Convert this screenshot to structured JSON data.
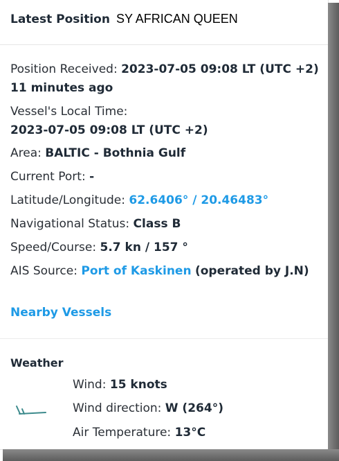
{
  "header": {
    "label": "Latest Position",
    "vessel_name": "SY AFRICAN QUEEN"
  },
  "details": {
    "position_received_label": "Position Received:",
    "position_received_value": "2023-07-05 09:08 LT (UTC +2)",
    "position_age": "11 minutes ago",
    "local_time_label": "Vessel's Local Time:",
    "local_time_value": "2023-07-05 09:08 LT (UTC +2)",
    "area_label": "Area:",
    "area_value": "BALTIC - Bothnia Gulf",
    "current_port_label": "Current Port:",
    "current_port_value": "-",
    "latlon_label": "Latitude/Longitude:",
    "latlon_value": "62.6406° / 20.46483°",
    "nav_status_label": "Navigational Status:",
    "nav_status_value": "Class B",
    "speed_course_label": "Speed/Course:",
    "speed_course_value": "5.7 kn / 157 °",
    "ais_source_label": "AIS Source:",
    "ais_source_link": "Port of Kaskinen",
    "ais_source_suffix": "(operated by J.N)"
  },
  "nearby_vessels_link": "Nearby Vessels",
  "weather": {
    "title": "Weather",
    "wind_label": "Wind:",
    "wind_value": "15 knots",
    "wind_direction_label": "Wind direction:",
    "wind_direction_value": "W (264°)",
    "air_temp_label": "Air Temperature:",
    "air_temp_value": "13°C",
    "wind_icon": "wind-barb-icon"
  },
  "colors": {
    "link": "#1e9ae6",
    "text": "#2a2f36",
    "wind_icon": "#3c8a8c"
  }
}
